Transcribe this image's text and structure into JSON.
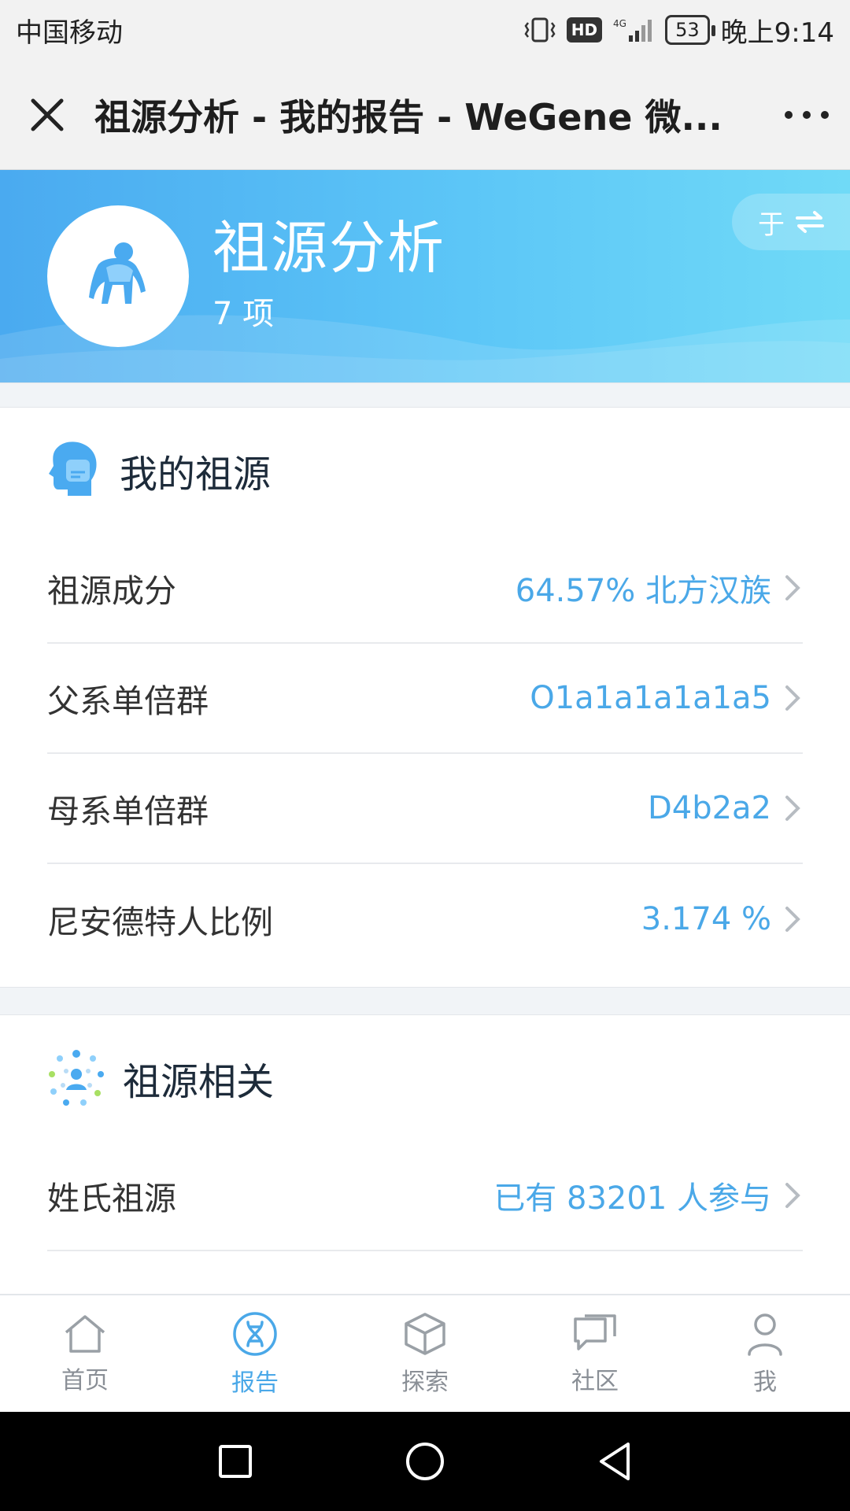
{
  "status_bar": {
    "carrier": "中国移动",
    "hd": "HD",
    "network": "4G",
    "battery": "53",
    "time": "晚上9:14"
  },
  "title_bar": {
    "title": "祖源分析 - 我的报告 - WeGene 微..."
  },
  "banner": {
    "title": "祖源分析",
    "count": "7 项",
    "user_name": "于",
    "icon": "ape-icon"
  },
  "sections": [
    {
      "title": "我的祖源",
      "icon": "head-profile-icon",
      "rows": [
        {
          "label": "祖源成分",
          "value": "64.57% 北方汉族"
        },
        {
          "label": "父系单倍群",
          "value": "O1a1a1a1a1a5"
        },
        {
          "label": "母系单倍群",
          "value": "D4b2a2"
        },
        {
          "label": "尼安德特人比例",
          "value": "3.174 %"
        }
      ]
    },
    {
      "title": "祖源相关",
      "icon": "network-people-icon",
      "rows": [
        {
          "label": "姓氏祖源",
          "value": "已有 83201 人参与"
        }
      ]
    }
  ],
  "tabs": [
    {
      "label": "首页",
      "icon": "home-icon",
      "active": false
    },
    {
      "label": "报告",
      "icon": "dna-icon",
      "active": true
    },
    {
      "label": "探索",
      "icon": "cube-icon",
      "active": false
    },
    {
      "label": "社区",
      "icon": "chat-icon",
      "active": false
    },
    {
      "label": "我",
      "icon": "user-icon",
      "active": false
    }
  ],
  "colors": {
    "accent": "#4aa8e8",
    "banner_start": "#4aaaf0",
    "banner_end": "#70daf7"
  }
}
